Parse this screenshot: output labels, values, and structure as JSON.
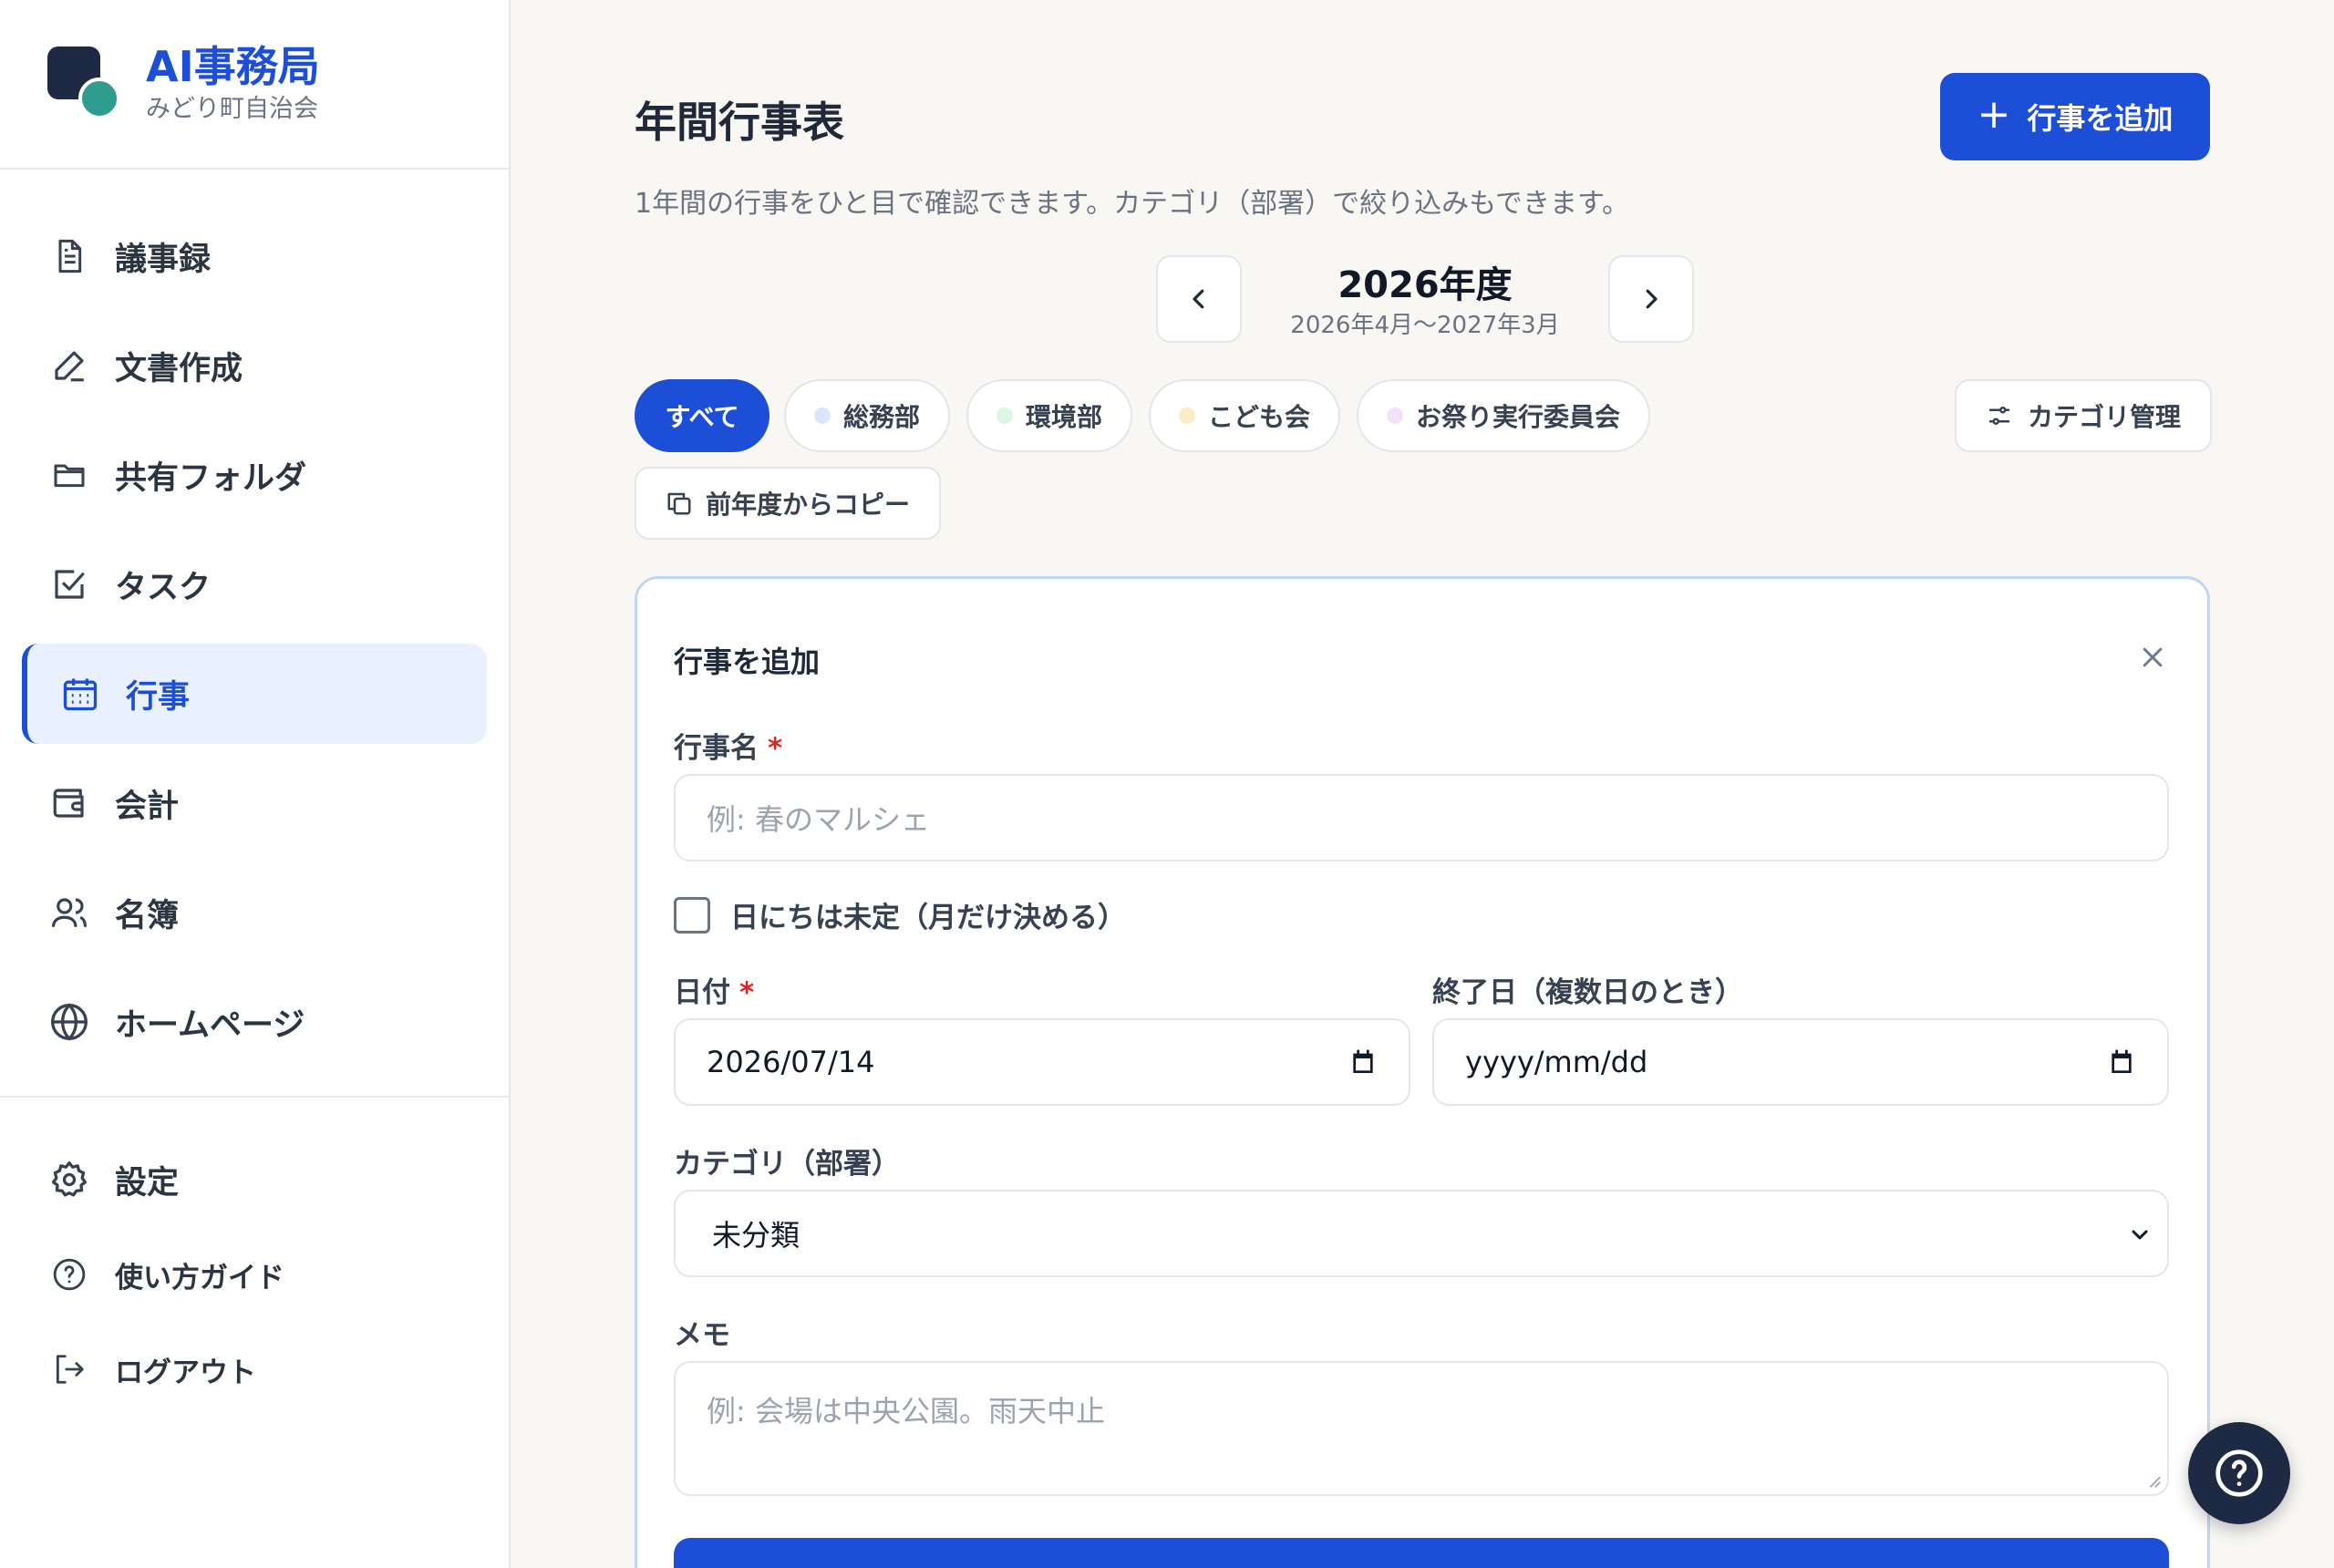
{
  "brand": {
    "title": "AI事務局",
    "subtitle": "みどり町自治会"
  },
  "sidebar": {
    "items": [
      {
        "label": "議事録",
        "icon": "document-icon"
      },
      {
        "label": "文書作成",
        "icon": "pen-icon"
      },
      {
        "label": "共有フォルダ",
        "icon": "folder-icon"
      },
      {
        "label": "タスク",
        "icon": "checkbox-icon"
      },
      {
        "label": "行事",
        "icon": "calendar-icon",
        "active": true
      },
      {
        "label": "会計",
        "icon": "wallet-icon"
      },
      {
        "label": "名簿",
        "icon": "users-icon"
      },
      {
        "label": "ホームページ",
        "icon": "globe-icon"
      }
    ],
    "bottom": [
      {
        "label": "設定",
        "icon": "gear-icon"
      },
      {
        "label": "使い方ガイド",
        "icon": "help-circle-icon"
      },
      {
        "label": "ログアウト",
        "icon": "logout-icon"
      }
    ]
  },
  "header": {
    "title": "年間行事表",
    "description": "1年間の行事をひと目で確認できます。カテゴリ（部署）で絞り込みもできます。",
    "add_button": "行事を追加"
  },
  "year_nav": {
    "title": "2026年度",
    "range": "2026年4月〜2027年3月"
  },
  "filters": {
    "chips": [
      {
        "label": "すべて",
        "active": true
      },
      {
        "label": "総務部",
        "dot_color": "#dbe6fb"
      },
      {
        "label": "環境部",
        "dot_color": "#dcf5e6"
      },
      {
        "label": "こども会",
        "dot_color": "#fbeec4"
      },
      {
        "label": "お祭り実行委員会",
        "dot_color": "#f2e3f8"
      }
    ],
    "category_manage": "カテゴリ管理",
    "copy_prev_year": "前年度からコピー"
  },
  "form": {
    "title": "行事を追加",
    "name_label": "行事名",
    "required_mark": "*",
    "name_placeholder": "例: 春のマルシェ",
    "undecided_label": "日にちは未定（月だけ決める）",
    "date_label": "日付",
    "date_value": "2026/07/14",
    "end_label": "終了日（複数日のとき）",
    "end_placeholder": "yyyy/mm/dd",
    "category_label": "カテゴリ（部署）",
    "category_value": "未分類",
    "memo_label": "メモ",
    "memo_placeholder": "例: 会場は中央公園。雨天中止"
  },
  "colors": {
    "accent": "#1d4ed8",
    "brand_dark": "#1e2a44",
    "brand_teal": "#2e9d8f"
  }
}
